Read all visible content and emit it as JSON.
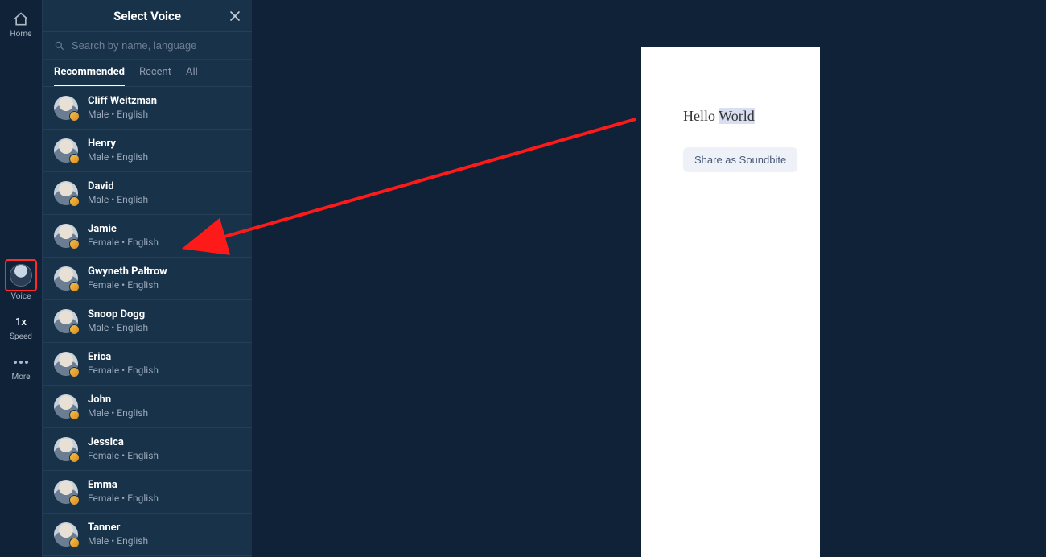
{
  "rail": {
    "home_label": "Home",
    "voice_label": "Voice",
    "speed_value": "1x",
    "speed_label": "Speed",
    "more_label": "More"
  },
  "panel": {
    "title": "Select Voice",
    "search_placeholder": "Search by name, language",
    "tabs": [
      {
        "label": "Recommended",
        "active": true
      },
      {
        "label": "Recent",
        "active": false
      },
      {
        "label": "All",
        "active": false
      }
    ],
    "voices": [
      {
        "name": "Cliff Weitzman",
        "sub": "Male • English"
      },
      {
        "name": "Henry",
        "sub": "Male • English"
      },
      {
        "name": "David",
        "sub": "Male • English"
      },
      {
        "name": "Jamie",
        "sub": "Female • English"
      },
      {
        "name": "Gwyneth Paltrow",
        "sub": "Female • English"
      },
      {
        "name": "Snoop Dogg",
        "sub": "Male • English"
      },
      {
        "name": "Erica",
        "sub": "Female • English"
      },
      {
        "name": "John",
        "sub": "Male • English"
      },
      {
        "name": "Jessica",
        "sub": "Female • English"
      },
      {
        "name": "Emma",
        "sub": "Female • English"
      },
      {
        "name": "Tanner",
        "sub": "Male • English"
      }
    ]
  },
  "document": {
    "text_plain": "Hello ",
    "text_selected": "World",
    "share_label": "Share as Soundbite"
  },
  "colors": {
    "bg": "#0f2238",
    "panel": "#18324a",
    "accent_red": "#ff2b2b",
    "badge_gold": "#e9a93a",
    "doc_sel": "#d7dff0"
  },
  "annotation": {
    "type": "arrow",
    "from_target": "document.text",
    "to_target": "panel.voices.Jamie"
  }
}
